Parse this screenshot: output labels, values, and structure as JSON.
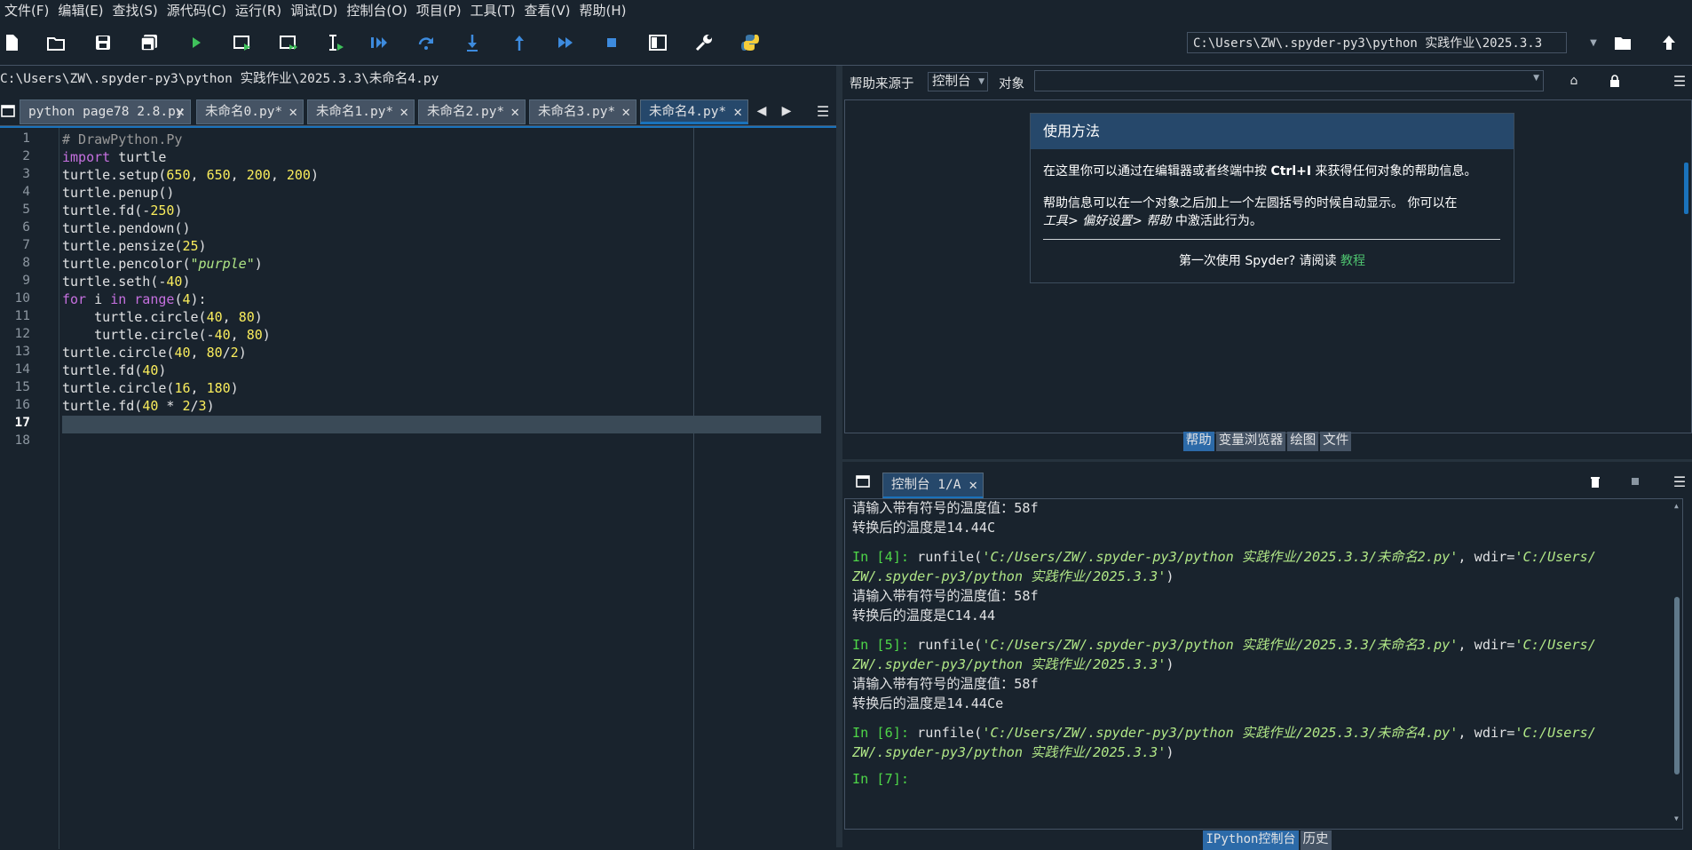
{
  "menu": [
    "文件(F)",
    "编辑(E)",
    "查找(S)",
    "源代码(C)",
    "运行(R)",
    "调试(D)",
    "控制台(O)",
    "项目(P)",
    "工具(T)",
    "查看(V)",
    "帮助(H)"
  ],
  "toolbar": {
    "working_dir": "C:\\Users\\ZW\\.spyder-py3\\python 实践作业\\2025.3.3"
  },
  "editor": {
    "file_path": "C:\\Users\\ZW\\.spyder-py3\\python 实践作业\\2025.3.3\\未命名4.py",
    "tabs": [
      {
        "label": "python page78 2.8.py"
      },
      {
        "label": "未命名0.py*"
      },
      {
        "label": "未命名1.py*"
      },
      {
        "label": "未命名2.py*"
      },
      {
        "label": "未命名3.py*"
      },
      {
        "label": "未命名4.py*"
      }
    ],
    "line_numbers": [
      "1",
      "2",
      "3",
      "4",
      "5",
      "6",
      "7",
      "8",
      "9",
      "10",
      "11",
      "12",
      "13",
      "14",
      "15",
      "16",
      "17",
      "18"
    ],
    "current_line": "17",
    "code": {
      "l1": "# DrawPython.Py",
      "l2_kw": "import",
      "l2_rest": " turtle",
      "l3_a": "turtle.setup(",
      "l3_n1": "650",
      "l3_c1": ", ",
      "l3_n2": "650",
      "l3_c2": ", ",
      "l3_n3": "200",
      "l3_c3": ", ",
      "l3_n4": "200",
      "l3_e": ")",
      "l4": "turtle.penup()",
      "l5_a": "turtle.fd(-",
      "l5_n": "250",
      "l5_e": ")",
      "l6": "turtle.pendown()",
      "l7_a": "turtle.pensize(",
      "l7_n": "25",
      "l7_e": ")",
      "l8_a": "turtle.pencolor(",
      "l8_s": "\"purple\"",
      "l8_e": ")",
      "l9_a": "turtle.seth(-",
      "l9_n": "40",
      "l9_e": ")",
      "l10_kw1": "for",
      "l10_b": " i ",
      "l10_kw2": "in",
      "l10_c": " ",
      "l10_fn": "range",
      "l10_d": "(",
      "l10_n": "4",
      "l10_e": "):",
      "l11_a": "    turtle.circle(",
      "l11_n1": "40",
      "l11_c": ", ",
      "l11_n2": "80",
      "l11_e": ")",
      "l12_a": "    turtle.circle(-",
      "l12_n1": "40",
      "l12_c": ", ",
      "l12_n2": "80",
      "l12_e": ")",
      "l13_a": "turtle.circle(",
      "l13_n1": "40",
      "l13_c": ", ",
      "l13_n2": "80",
      "l13_d": "/",
      "l13_n3": "2",
      "l13_e": ")",
      "l14_a": "turtle.fd(",
      "l14_n": "40",
      "l14_e": ")",
      "l15_a": "turtle.circle(",
      "l15_n1": "16",
      "l15_c": ", ",
      "l15_n2": "180",
      "l15_e": ")",
      "l16_a": "turtle.fd(",
      "l16_n1": "40",
      "l16_c": " * ",
      "l16_n2": "2",
      "l16_d": "/",
      "l16_n3": "3",
      "l16_e": ")"
    }
  },
  "help": {
    "source_label": "帮助来源于",
    "source_value": "控制台",
    "object_label": "对象",
    "card_title": "使用方法",
    "p1_a": "在这里你可以通过在编辑器或者终端中按 ",
    "p1_b": "Ctrl+I",
    "p1_c": " 来获得任何对象的帮助信息。",
    "p2": "帮助信息可以在一个对象之后加上一个左圆括号的时候自动显示。 你可以在",
    "p3_a": "工具> 偏好设置> 帮助",
    "p3_b": " 中激活此行为。",
    "first_time": "第一次使用 Spyder? 请阅读 ",
    "tutorial": "教程",
    "bottom_tabs": [
      "帮助",
      "变量浏览器",
      "绘图",
      "文件"
    ]
  },
  "console": {
    "tab_label": "控制台 1/A",
    "lines": {
      "c1": "请输入带有符号的温度值：58f",
      "c2": "转换后的温度是14.44C",
      "c3_p": "In [4]:",
      "c3_a": " runfile(",
      "c3_s1": "'C:/Users/ZW/.spyder-py3/python 实践作业/2025.3.3/未命名2.py'",
      "c3_b": ", wdir=",
      "c3_s2": "'C:/Users/",
      "c4_s": "ZW/.spyder-py3/python 实践作业/2025.3.3'",
      "c4_e": ")",
      "c5": "请输入带有符号的温度值：58f",
      "c6": "转换后的温度是C14.44",
      "c7_p": "In [5]:",
      "c7_a": " runfile(",
      "c7_s1": "'C:/Users/ZW/.spyder-py3/python 实践作业/2025.3.3/未命名3.py'",
      "c7_b": ", wdir=",
      "c7_s2": "'C:/Users/",
      "c8_s": "ZW/.spyder-py3/python 实践作业/2025.3.3'",
      "c8_e": ")",
      "c9": "请输入带有符号的温度值：58f",
      "c10": "转换后的温度是14.44Ce",
      "c11_p": "In [6]:",
      "c11_a": " runfile(",
      "c11_s1": "'C:/Users/ZW/.spyder-py3/python 实践作业/2025.3.3/未命名4.py'",
      "c11_b": ", wdir=",
      "c11_s2": "'C:/Users/",
      "c12_s": "ZW/.spyder-py3/python 实践作业/2025.3.3'",
      "c12_e": ")",
      "c13_p": "In [7]:"
    },
    "bottom_tabs": [
      "IPython控制台",
      "历史"
    ]
  },
  "colors": {
    "accent": "#1a72bb",
    "prompt": "#4ed648",
    "string": "#b0e686",
    "keyword": "#c670e0",
    "number": "#faed5c"
  }
}
